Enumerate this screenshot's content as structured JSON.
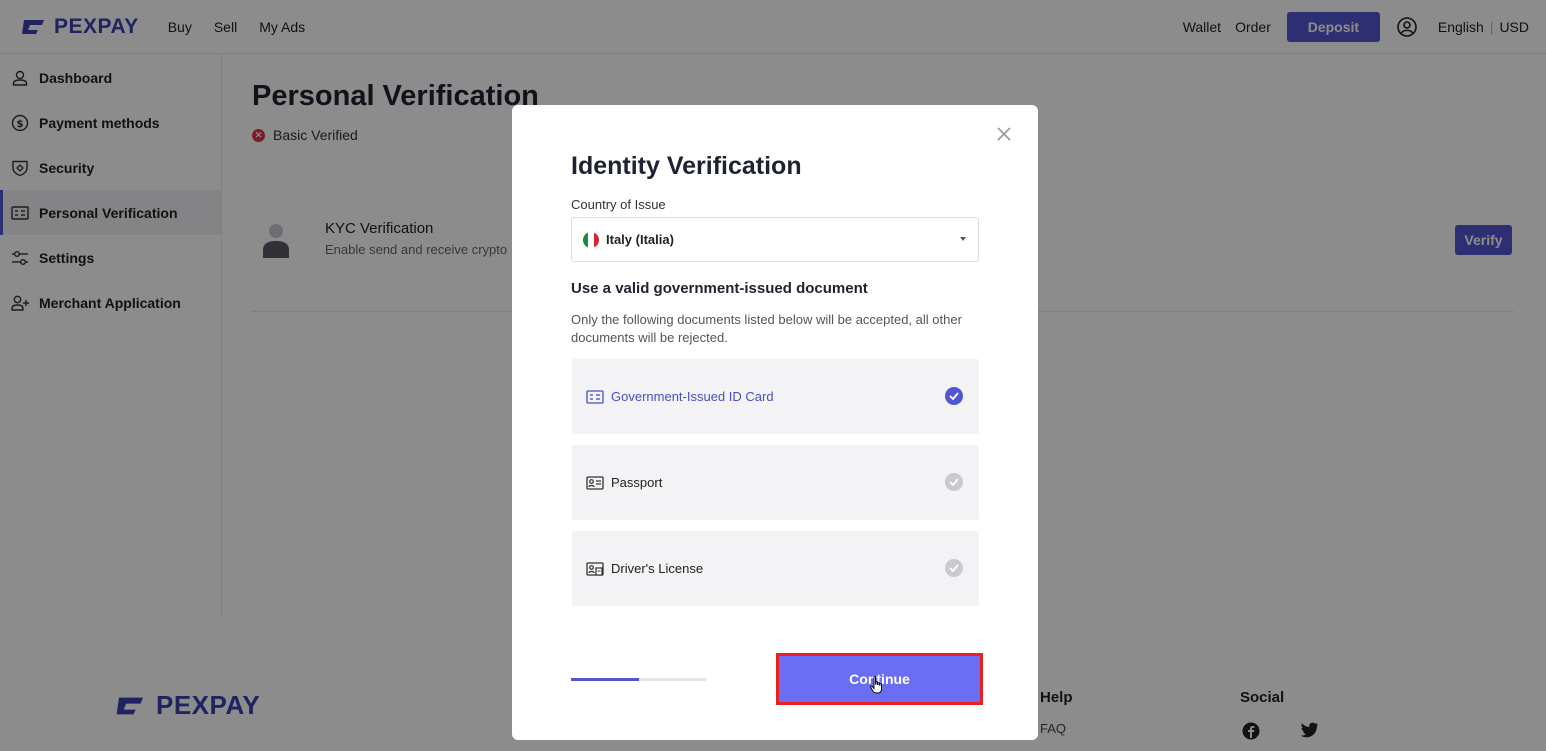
{
  "brand": {
    "name": "PEXPAY",
    "color": "#3d40b0"
  },
  "topnav": {
    "items": [
      "Buy",
      "Sell",
      "My Ads"
    ]
  },
  "topright": {
    "wallet": "Wallet",
    "order": "Order",
    "deposit": "Deposit",
    "language": "English",
    "currency": "USD"
  },
  "sidebar": {
    "items": [
      {
        "label": "Dashboard",
        "icon": "user-icon"
      },
      {
        "label": "Payment methods",
        "icon": "dollar-icon"
      },
      {
        "label": "Security",
        "icon": "shield-icon"
      },
      {
        "label": "Personal Verification",
        "icon": "id-card-icon",
        "active": true
      },
      {
        "label": "Settings",
        "icon": "sliders-icon"
      },
      {
        "label": "Merchant Application",
        "icon": "user-plus-icon"
      }
    ]
  },
  "main": {
    "title": "Personal Verification",
    "status": "Basic Verified",
    "kyc": {
      "title": "KYC Verification",
      "subtitle": "Enable send and receive crypto",
      "button": "Verify"
    }
  },
  "footer": {
    "help_heading": "Help",
    "faq": "FAQ",
    "social_heading": "Social"
  },
  "modal": {
    "title": "Identity Verification",
    "country_label": "Country of Issue",
    "country_value": "Italy (Italia)",
    "doc_heading": "Use a valid government-issued document",
    "doc_note": "Only the following documents listed below will be accepted, all other documents will be rejected.",
    "options": [
      {
        "label": "Government-Issued ID Card",
        "selected": true
      },
      {
        "label": "Passport",
        "selected": false
      },
      {
        "label": "Driver's License",
        "selected": false
      }
    ],
    "progress": 0.5,
    "continue": "Continue"
  },
  "colors": {
    "accent": "#5256d0",
    "highlight": "#e8201e",
    "error": "#e0304a"
  }
}
